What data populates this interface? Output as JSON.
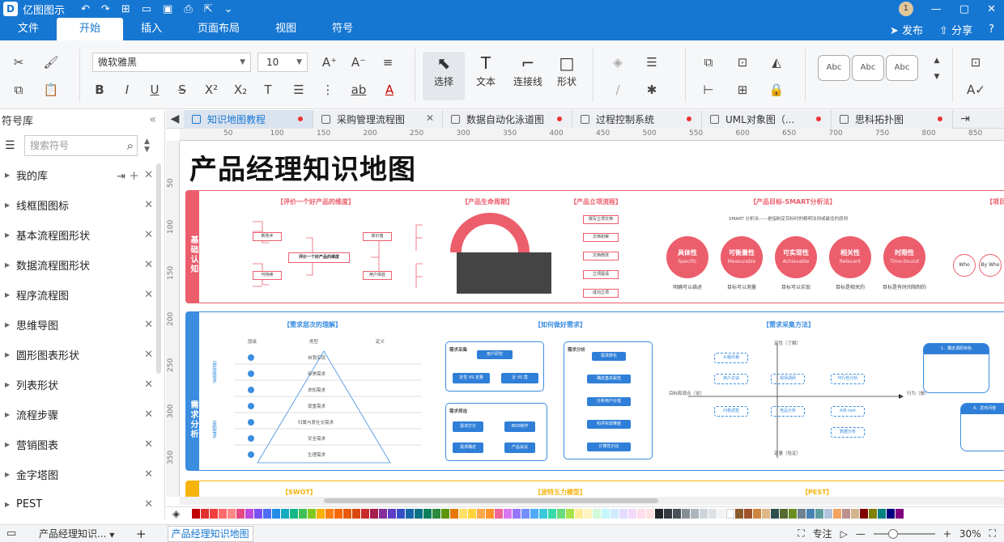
{
  "app": {
    "name": "亿图图示",
    "user_badge": "1"
  },
  "menu_tabs": [
    "文件",
    "开始",
    "插入",
    "页面布局",
    "视图",
    "符号"
  ],
  "menu_right": {
    "publish": "发布",
    "share": "分享",
    "help": "?"
  },
  "ribbon": {
    "font_family": "微软雅黑",
    "font_size": "10",
    "tools": [
      {
        "label": "选择",
        "icon": "cursor-icon"
      },
      {
        "label": "文本",
        "icon": "text-tool-icon"
      },
      {
        "label": "连接线",
        "icon": "connector-icon"
      },
      {
        "label": "形状",
        "icon": "shape-icon"
      }
    ],
    "style_presets": [
      "Abc",
      "Abc",
      "Abc"
    ]
  },
  "left_panel": {
    "title": "符号库",
    "search_placeholder": "搜索符号",
    "libraries": [
      "我的库",
      "线框图图标",
      "基本流程图形状",
      "数据流程图形状",
      "程序流程图",
      "思维导图",
      "圆形图表形状",
      "列表形状",
      "流程步骤",
      "营销图表",
      "金字塔图",
      "PEST"
    ]
  },
  "doc_tabs": [
    {
      "label": "知识地图教程",
      "active": true,
      "modified": true
    },
    {
      "label": "采购管理流程图",
      "active": false,
      "closable": true
    },
    {
      "label": "数据自动化泳道图",
      "active": false,
      "modified": true
    },
    {
      "label": "过程控制系统",
      "active": false,
      "modified": true
    },
    {
      "label": "UML对象图（...",
      "active": false,
      "modified": true
    },
    {
      "label": "思科拓扑图",
      "active": false,
      "modified": true
    }
  ],
  "ruler_h": [
    "50",
    "100",
    "150",
    "200",
    "250",
    "300",
    "350",
    "400",
    "450",
    "500",
    "550",
    "600",
    "650",
    "700",
    "750",
    "800",
    "850"
  ],
  "ruler_v": [
    "50",
    "100",
    "150",
    "200",
    "250",
    "300",
    "350"
  ],
  "canvas": {
    "title": "产品经理知识地图",
    "section1": {
      "side": "基础认知",
      "t1": "【评价一个好产品的维度】",
      "t2": "【产品生命周期】",
      "t3": "【产品立项流程】",
      "t4": "【产品目标-SMART分析法】",
      "t5": "【项目",
      "smart_desc": "SMART 分析法——是指制定目标时的精明法则或最佳的原则",
      "circles": [
        {
          "title": "具体性",
          "sub": "Specific",
          "cap": "明确可以描述"
        },
        {
          "title": "可衡量性",
          "sub": "Measurable",
          "cap": "目标可以测量"
        },
        {
          "title": "可实现性",
          "sub": "Achievable",
          "cap": "目标可以实现"
        },
        {
          "title": "相关性",
          "sub": "Relevant",
          "cap": "目标是相关的"
        },
        {
          "title": "时限性",
          "sub": "Time-bound",
          "cap": "目标是有时间限制的"
        }
      ],
      "center_node": "评价一个好产品的维度",
      "left_nodes": [
        "新技术",
        "可持续",
        "高价值",
        "用户体验"
      ],
      "flow_nodes": [
        "撰写立项文档",
        "文档初审",
        "文档修改",
        "立项提请",
        "成功立项"
      ],
      "who": [
        "Who",
        "By Who"
      ]
    },
    "section2": {
      "side": "需求分析",
      "t1": "【需求层次的理解】",
      "t2": "【如何做好需求】",
      "t3": "【需求采集方法】",
      "pyramid_labels": [
        "自我实现",
        "审美需求",
        "求知需求",
        "尊重需求",
        "归属与爱社交需求",
        "安全需求",
        "生理需求"
      ],
      "group_top": "高层级需求",
      "group_bottom": "基础需求",
      "col_heads": [
        "层级",
        "类型",
        "定义"
      ],
      "collect_title": "需求采集",
      "user_research": "用户研究",
      "qual": "定性 VS 定量",
      "prev": "近 VS 竟",
      "analysis_title": "需求分析",
      "analysis": [
        "需求转化",
        "确定基本属性",
        "分析用户价值",
        "初评实现难度",
        "计算性价比"
      ],
      "filter_title": "需求筛选",
      "filter": [
        "需求打分",
        "BRD制作",
        "需求确定",
        "产品会议"
      ],
      "axis_top": "定性（了解）",
      "axis_bottom": "定量（验证）",
      "axis_left": "目标和观点（说）",
      "axis_right": "行为（做）",
      "methods": [
        "头脑风暴",
        "用户访谈",
        "现场调研",
        "可行性分析",
        "问卷调查",
        "竞品分析",
        "A/B test",
        "数据分析"
      ],
      "card1": "1、确定调研目标",
      "card2": "4、发布问卷"
    },
    "section3": {
      "t1": "【SWOT】",
      "t2": "【波特五力模型】",
      "t3": "【PEST】"
    }
  },
  "statusbar": {
    "page_selector": "产品经理知识...",
    "add": "+",
    "active_page": "产品经理知识地图",
    "focus": "专注",
    "zoom": "30%"
  },
  "palette_colors": [
    "#c00000",
    "#e03131",
    "#f03e3e",
    "#ff6b6b",
    "#ff8787",
    "#e64980",
    "#be4bdb",
    "#7950f2",
    "#4c6ef5",
    "#228be6",
    "#15aabf",
    "#12b886",
    "#40c057",
    "#82c91e",
    "#fab005",
    "#fd7e14",
    "#f76707",
    "#e8590c",
    "#d9480f",
    "#c92a2a",
    "#a61e4d",
    "#862e9c",
    "#5f3dc4",
    "#364fc7",
    "#1864ab",
    "#0b7285",
    "#087f5b",
    "#2b8a3e",
    "#5c940d",
    "#e67700",
    "#ffe066",
    "#ffd43b",
    "#ffa94d",
    "#ff922b",
    "#f06595",
    "#da77f2",
    "#9775fa",
    "#748ffc",
    "#4dabf7",
    "#3bc9db",
    "#38d9a9",
    "#69db7c",
    "#a9e34b",
    "#ffec99",
    "#fff3bf",
    "#d3f9d8",
    "#c5f6fa",
    "#d0ebff",
    "#e5dbff",
    "#f3d9fa",
    "#ffdeeb",
    "#ffe3e3",
    "#212529",
    "#343a40",
    "#495057",
    "#868e96",
    "#adb5bd",
    "#ced4da",
    "#dee2e6",
    "#f1f3f5",
    "#ffffff",
    "#8b5a2b",
    "#a0522d",
    "#cd853f",
    "#deb887",
    "#2f4f4f",
    "#556b2f",
    "#6b8e23",
    "#708090",
    "#4682b4",
    "#5f9ea0",
    "#b0c4de",
    "#f4a460",
    "#bc8f8f",
    "#d2b48c",
    "#800000",
    "#808000",
    "#008080",
    "#000080",
    "#800080"
  ]
}
